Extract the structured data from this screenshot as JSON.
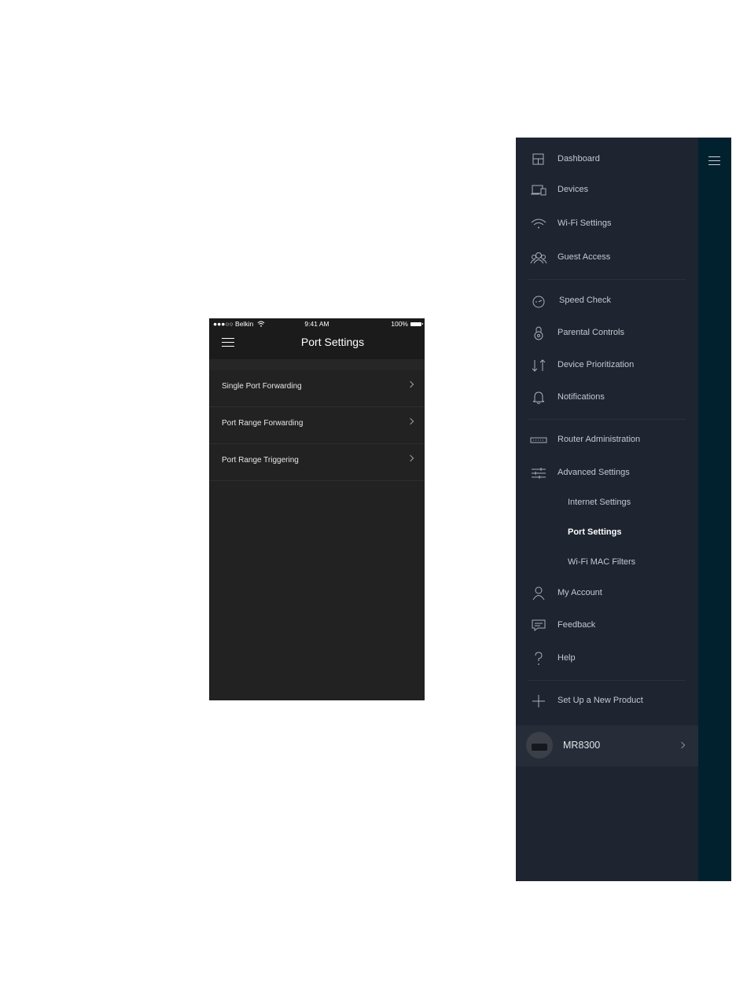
{
  "phone": {
    "status": {
      "carrier": "●●●○○ Belkin",
      "wifi_icon": "wifi-icon",
      "time": "9:41 AM",
      "battery": "100%"
    },
    "header": {
      "title": "Port Settings",
      "menu_icon": "hamburger-icon"
    },
    "items": [
      {
        "label": "Single Port Forwarding"
      },
      {
        "label": "Port Range Forwarding"
      },
      {
        "label": "Port Range Triggering"
      }
    ]
  },
  "drawer": {
    "items": [
      {
        "label": "Dashboard",
        "icon": "dashboard-icon"
      },
      {
        "label": "Devices",
        "icon": "devices-icon"
      },
      {
        "label": "Wi-Fi Settings",
        "icon": "wifi-icon"
      },
      {
        "label": "Guest Access",
        "icon": "guest-icon"
      },
      {
        "label": "Speed Check",
        "icon": "speedometer-icon"
      },
      {
        "label": "Parental Controls",
        "icon": "lock-icon"
      },
      {
        "label": "Device Prioritization",
        "icon": "priority-arrows-icon"
      },
      {
        "label": "Notifications",
        "icon": "bell-icon"
      },
      {
        "label": "Router Administration",
        "icon": "router-icon"
      },
      {
        "label": "Advanced Settings",
        "icon": "sliders-icon"
      },
      {
        "label": "My Account",
        "icon": "user-icon"
      },
      {
        "label": "Feedback",
        "icon": "feedback-icon"
      },
      {
        "label": "Help",
        "icon": "help-icon"
      },
      {
        "label": "Set Up a New Product",
        "icon": "plus-icon"
      }
    ],
    "advanced_sub": [
      {
        "label": "Internet Settings"
      },
      {
        "label": "Port Settings",
        "active": true
      },
      {
        "label": "Wi-Fi MAC Filters"
      }
    ],
    "device": {
      "name": "MR8300"
    }
  },
  "colors": {
    "phone_bg": "#222222",
    "drawer_bg": "#1e2430",
    "strip_bg": "#01212f"
  }
}
